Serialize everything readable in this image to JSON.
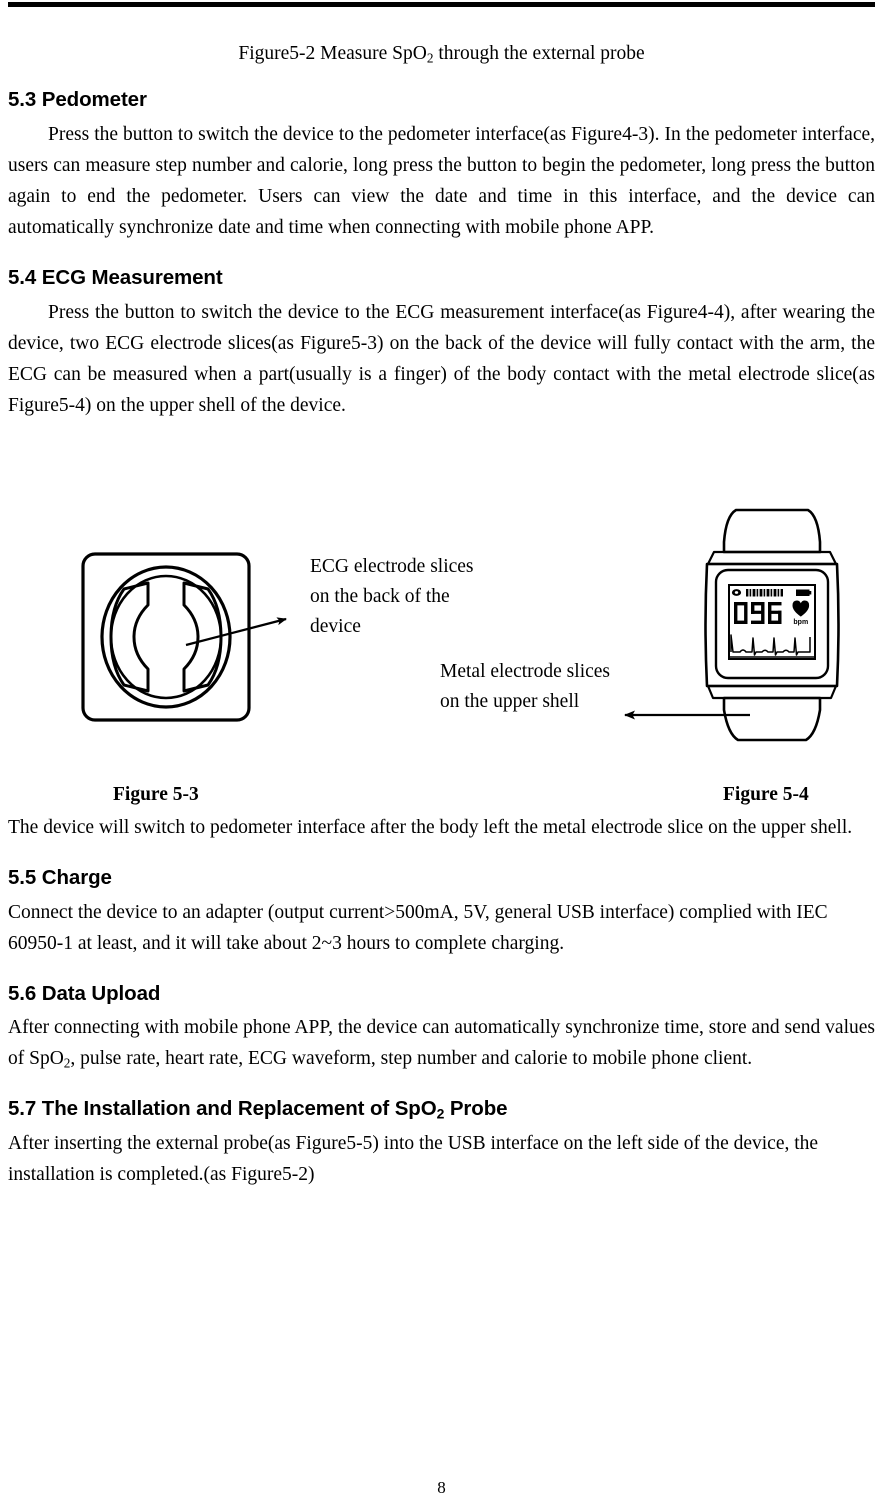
{
  "document": {
    "page_number": "8",
    "top_figure_caption": {
      "prefix": "Figure5-2 Measure SpO",
      "subscript": "2",
      "suffix": " through the external probe"
    }
  },
  "sections": [
    {
      "id": "5.3",
      "heading": "5.3 Pedometer",
      "paragraph": "Press the button to switch the device to the pedometer interface(as Figure4-3). In the pedometer interface, users can measure step number and calorie, long press the button to begin the pedometer, long press the button again to end the pedometer. Users can view the date and time in this interface, and the device can automatically synchronize date and time when connecting with mobile phone APP."
    },
    {
      "id": "5.4",
      "heading": "5.4 ECG Measurement",
      "paragraph": "Press the button to switch the device to the ECG measurement interface(as Figure4-4), after wearing the device, two ECG electrode slices(as Figure5-3) on the back of the device will fully contact with the arm, the ECG can be measured when a part(usually is a finger) of the body contact with the metal electrode slice(as Figure5-4) on the upper shell of the device."
    },
    {
      "id": "5.5",
      "heading": "5.5 Charge",
      "paragraph": "Connect the device to an adapter (output current>500mA, 5V, general USB interface) complied with IEC 60950-1 at least, and it will take about 2~3 hours to complete charging."
    },
    {
      "id": "5.6",
      "heading": "5.6 Data Upload",
      "paragraph_part1": "After connecting with mobile phone APP, the device can automatically synchronize time, store and send values of SpO",
      "paragraph_sub": "2",
      "paragraph_part2": ", pulse rate, heart rate, ECG waveform, step number and calorie to mobile phone client."
    },
    {
      "id": "5.7",
      "heading_part1": "5.7 The Installation and Replacement of SpO",
      "heading_sub": "2",
      "heading_part2": " Probe",
      "paragraph": "After inserting the external probe(as Figure5-5) into the USB interface on the left side of the device, the installation is completed.(as Figure5-2)"
    }
  ],
  "figure_area": {
    "after_figure_paragraph": "The device will switch to pedometer interface after the body left the metal electrode slice on the upper shell.",
    "annotations": [
      {
        "id": "ecg-electrode",
        "line1": "ECG electrode slices",
        "line2": "on the back of the",
        "line3": "device"
      },
      {
        "id": "metal-electrode",
        "line1": "Metal electrode slices",
        "line2": "on the upper shell"
      }
    ],
    "captions": {
      "left": "Figure 5-3",
      "right": "Figure 5-4"
    },
    "watch_display": {
      "heart_rate": "096",
      "unit": "bpm"
    }
  },
  "colors": {
    "ink": "#000000",
    "paper": "#ffffff"
  }
}
